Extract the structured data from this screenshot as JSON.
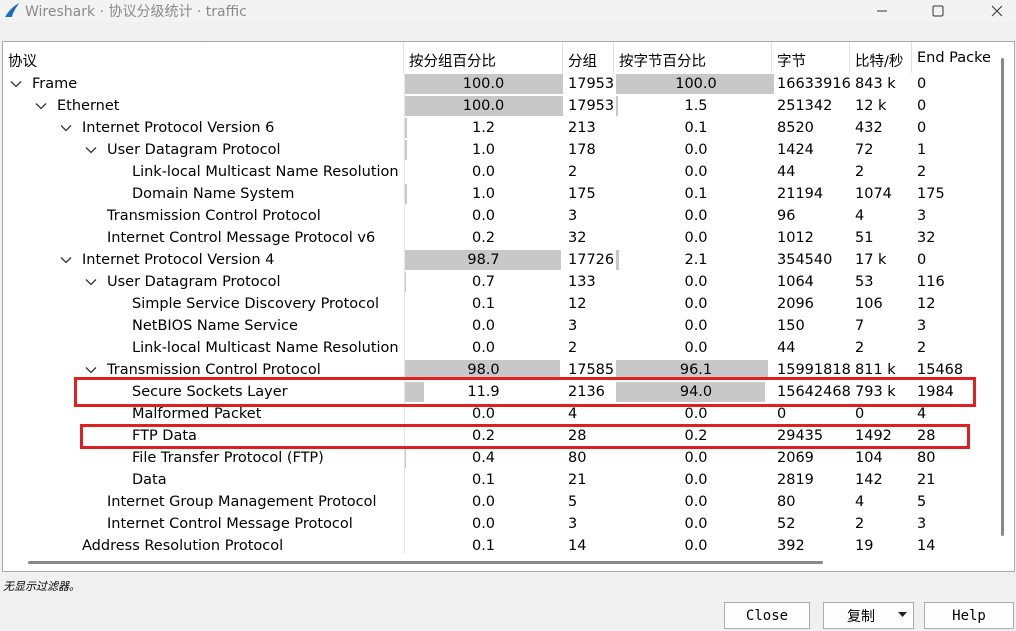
{
  "window": {
    "title": "Wireshark · 协议分级统计 · traffic"
  },
  "columns": [
    "协议",
    "按分组百分比",
    "分组",
    "按字节百分比",
    "字节",
    "比特/秒",
    "End Packe"
  ],
  "rows": [
    {
      "name": "Frame",
      "pkt_pct": "100.0",
      "pkt_pct_value": 100.0,
      "packets": "17953",
      "byte_pct": "100.0",
      "byte_pct_value": 100.0,
      "bytes": "16633916",
      "bps": "843 k",
      "end": "0",
      "expanded": true
    },
    {
      "name": "Ethernet",
      "pkt_pct": "100.0",
      "pkt_pct_value": 100.0,
      "packets": "17953",
      "byte_pct": "1.5",
      "byte_pct_value": 1.5,
      "bytes": "251342",
      "bps": "12 k",
      "end": "0",
      "expanded": true
    },
    {
      "name": "Internet Protocol Version 6",
      "pkt_pct": "1.2",
      "pkt_pct_value": 1.2,
      "packets": "213",
      "byte_pct": "0.1",
      "byte_pct_value": 0.1,
      "bytes": "8520",
      "bps": "432",
      "end": "0",
      "expanded": true
    },
    {
      "name": "User Datagram Protocol",
      "pkt_pct": "1.0",
      "pkt_pct_value": 1.0,
      "packets": "178",
      "byte_pct": "0.0",
      "byte_pct_value": 0.0,
      "bytes": "1424",
      "bps": "72",
      "end": "1",
      "expanded": true
    },
    {
      "name": "Link-local Multicast Name Resolution",
      "pkt_pct": "0.0",
      "pkt_pct_value": 0.0,
      "packets": "2",
      "byte_pct": "0.0",
      "byte_pct_value": 0.0,
      "bytes": "44",
      "bps": "2",
      "end": "2"
    },
    {
      "name": "Domain Name System",
      "pkt_pct": "1.0",
      "pkt_pct_value": 1.0,
      "packets": "175",
      "byte_pct": "0.1",
      "byte_pct_value": 0.1,
      "bytes": "21194",
      "bps": "1074",
      "end": "175"
    },
    {
      "name": "Transmission Control Protocol",
      "pkt_pct": "0.0",
      "pkt_pct_value": 0.0,
      "packets": "3",
      "byte_pct": "0.0",
      "byte_pct_value": 0.0,
      "bytes": "96",
      "bps": "4",
      "end": "3"
    },
    {
      "name": "Internet Control Message Protocol v6",
      "pkt_pct": "0.2",
      "pkt_pct_value": 0.2,
      "packets": "32",
      "byte_pct": "0.0",
      "byte_pct_value": 0.0,
      "bytes": "1012",
      "bps": "51",
      "end": "32"
    },
    {
      "name": "Internet Protocol Version 4",
      "pkt_pct": "98.7",
      "pkt_pct_value": 98.7,
      "packets": "17726",
      "byte_pct": "2.1",
      "byte_pct_value": 2.1,
      "bytes": "354540",
      "bps": "17 k",
      "end": "0",
      "expanded": true
    },
    {
      "name": "User Datagram Protocol",
      "pkt_pct": "0.7",
      "pkt_pct_value": 0.7,
      "packets": "133",
      "byte_pct": "0.0",
      "byte_pct_value": 0.0,
      "bytes": "1064",
      "bps": "53",
      "end": "116",
      "expanded": true
    },
    {
      "name": "Simple Service Discovery Protocol",
      "pkt_pct": "0.1",
      "pkt_pct_value": 0.1,
      "packets": "12",
      "byte_pct": "0.0",
      "byte_pct_value": 0.0,
      "bytes": "2096",
      "bps": "106",
      "end": "12"
    },
    {
      "name": "NetBIOS Name Service",
      "pkt_pct": "0.0",
      "pkt_pct_value": 0.0,
      "packets": "3",
      "byte_pct": "0.0",
      "byte_pct_value": 0.0,
      "bytes": "150",
      "bps": "7",
      "end": "3"
    },
    {
      "name": "Link-local Multicast Name Resolution",
      "pkt_pct": "0.0",
      "pkt_pct_value": 0.0,
      "packets": "2",
      "byte_pct": "0.0",
      "byte_pct_value": 0.0,
      "bytes": "44",
      "bps": "2",
      "end": "2"
    },
    {
      "name": "Transmission Control Protocol",
      "pkt_pct": "98.0",
      "pkt_pct_value": 98.0,
      "packets": "17585",
      "byte_pct": "96.1",
      "byte_pct_value": 96.1,
      "bytes": "15991818",
      "bps": "811 k",
      "end": "15468",
      "expanded": true
    },
    {
      "name": "Secure Sockets Layer",
      "pkt_pct": "11.9",
      "pkt_pct_value": 11.9,
      "packets": "2136",
      "byte_pct": "94.0",
      "byte_pct_value": 94.0,
      "bytes": "15642468",
      "bps": "793 k",
      "end": "1984",
      "highlighted": true
    },
    {
      "name": "Malformed Packet",
      "pkt_pct": "0.0",
      "pkt_pct_value": 0.0,
      "packets": "4",
      "byte_pct": "0.0",
      "byte_pct_value": 0.0,
      "bytes": "0",
      "bps": "0",
      "end": "4"
    },
    {
      "name": "FTP Data",
      "pkt_pct": "0.2",
      "pkt_pct_value": 0.2,
      "packets": "28",
      "byte_pct": "0.2",
      "byte_pct_value": 0.2,
      "bytes": "29435",
      "bps": "1492",
      "end": "28",
      "highlighted": true
    },
    {
      "name": "File Transfer Protocol (FTP)",
      "pkt_pct": "0.4",
      "pkt_pct_value": 0.4,
      "packets": "80",
      "byte_pct": "0.0",
      "byte_pct_value": 0.0,
      "bytes": "2069",
      "bps": "104",
      "end": "80"
    },
    {
      "name": "Data",
      "pkt_pct": "0.1",
      "pkt_pct_value": 0.1,
      "packets": "21",
      "byte_pct": "0.0",
      "byte_pct_value": 0.0,
      "bytes": "2819",
      "bps": "142",
      "end": "21"
    },
    {
      "name": "Internet Group Management Protocol",
      "pkt_pct": "0.0",
      "pkt_pct_value": 0.0,
      "packets": "5",
      "byte_pct": "0.0",
      "byte_pct_value": 0.0,
      "bytes": "80",
      "bps": "4",
      "end": "5"
    },
    {
      "name": "Internet Control Message Protocol",
      "pkt_pct": "0.0",
      "pkt_pct_value": 0.0,
      "packets": "3",
      "byte_pct": "0.0",
      "byte_pct_value": 0.0,
      "bytes": "52",
      "bps": "2",
      "end": "3"
    },
    {
      "name": "Address Resolution Protocol",
      "pkt_pct": "0.1",
      "pkt_pct_value": 0.1,
      "packets": "14",
      "byte_pct": "0.0",
      "byte_pct_value": 0.0,
      "bytes": "392",
      "bps": "19",
      "end": "14"
    }
  ],
  "status": "无显示过滤器。",
  "buttons": {
    "close": "Close",
    "copy": "复制",
    "help": "Help"
  },
  "colors": {
    "highlight_box": "#e02020",
    "percent_bar": "#c8c8c8"
  }
}
